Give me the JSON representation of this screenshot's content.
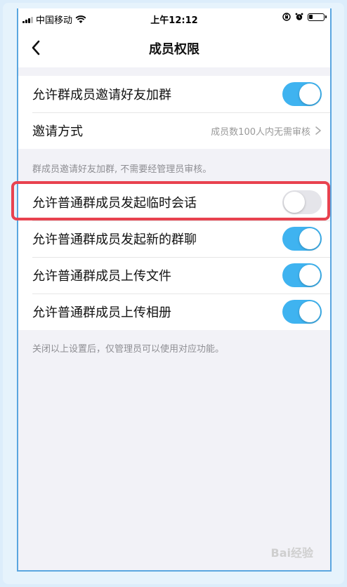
{
  "status_bar": {
    "carrier": "中国移动",
    "time": "上午12:12",
    "icons": [
      "signal-icon",
      "wifi-icon",
      "rotation-lock-icon",
      "alarm-icon",
      "battery-icon"
    ]
  },
  "nav": {
    "title": "成员权限",
    "back_icon": "chevron-left-icon"
  },
  "section1": {
    "rows": [
      {
        "label": "允许群成员邀请好友加群",
        "toggle": true
      },
      {
        "label": "邀请方式",
        "value": "成员数100人内无需审核"
      }
    ],
    "hint": "群成员邀请好友加群, 不需要经管理员审核。"
  },
  "section2": {
    "rows": [
      {
        "label": "允许普通群成员发起临时会话",
        "toggle": false,
        "highlighted": true
      },
      {
        "label": "允许普通群成员发起新的群聊",
        "toggle": true
      },
      {
        "label": "允许普通群成员上传文件",
        "toggle": true
      },
      {
        "label": "允许普通群成员上传相册",
        "toggle": true
      }
    ],
    "hint": "关闭以上设置后，仅管理员可以使用对应功能。"
  },
  "colors": {
    "toggle_on": "#3fb3f0",
    "toggle_off": "#e5e5ea",
    "highlight": "#e8424f",
    "phone_border": "#5aa6e0"
  },
  "watermark": "Bai经验"
}
